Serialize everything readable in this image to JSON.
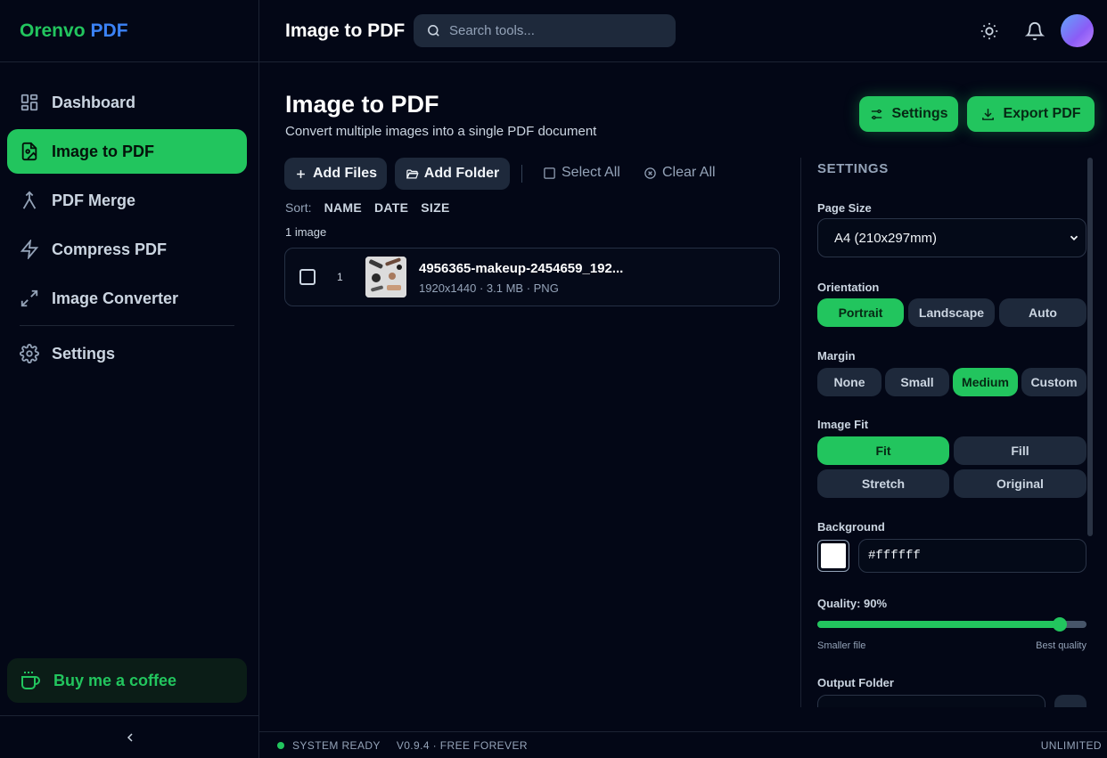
{
  "brand": {
    "name_a": "Orenvo",
    "name_b": "PDF",
    "accent": "#22c55e",
    "accent_blue": "#3b82f6"
  },
  "sidebar": {
    "items": [
      {
        "label": "Dashboard",
        "icon": "dashboard-grid-icon",
        "active": false
      },
      {
        "label": "Image to PDF",
        "icon": "file-image-icon",
        "active": true
      },
      {
        "label": "PDF Merge",
        "icon": "merge-icon",
        "active": false
      },
      {
        "label": "Compress PDF",
        "icon": "lightning-icon",
        "active": false
      },
      {
        "label": "Image Converter",
        "icon": "expand-arrows-icon",
        "active": false
      },
      {
        "label": "Settings",
        "icon": "gear-icon",
        "active": false
      }
    ],
    "coffee_label": "Buy me a coffee",
    "collapse_icon": "chevron-left-icon"
  },
  "header": {
    "title": "Image to PDF",
    "search_placeholder": "Search tools...",
    "icons": [
      "sun-icon",
      "bell-icon",
      "avatar"
    ]
  },
  "main": {
    "title": "Image to PDF",
    "subtitle": "Convert multiple images into a single PDF document",
    "settings_button": "Settings",
    "export_button": "Export PDF",
    "toolbar": {
      "add_files": "Add Files",
      "add_folder": "Add Folder",
      "select_all": "Select All",
      "clear_all": "Clear All"
    },
    "sort": {
      "label": "Sort:",
      "options": [
        "NAME",
        "DATE",
        "SIZE"
      ]
    },
    "count": "1 image",
    "files": [
      {
        "index": "1",
        "name": "4956365-makeup-2454659_192...",
        "meta": "1920x1440 · 3.1 MB · PNG"
      }
    ]
  },
  "settings_panel": {
    "title": "SETTINGS",
    "page_size": {
      "label": "Page Size",
      "value": "A4 (210x297mm)"
    },
    "orientation": {
      "label": "Orientation",
      "options": [
        "Portrait",
        "Landscape",
        "Auto"
      ],
      "selected": "Portrait"
    },
    "margin": {
      "label": "Margin",
      "options": [
        "None",
        "Small",
        "Medium",
        "Custom"
      ],
      "selected": "Medium"
    },
    "image_fit": {
      "label": "Image Fit",
      "options": [
        "Fit",
        "Fill",
        "Stretch",
        "Original"
      ],
      "selected": "Fit"
    },
    "background": {
      "label": "Background",
      "value": "#ffffff"
    },
    "quality": {
      "label": "Quality: 90%",
      "value": 90,
      "min_caption": "Smaller file",
      "max_caption": "Best quality"
    },
    "output_folder": {
      "label": "Output Folder"
    }
  },
  "status": {
    "ready": "SYSTEM READY",
    "version": "V0.9.4 · FREE FOREVER",
    "plan": "UNLIMITED"
  }
}
